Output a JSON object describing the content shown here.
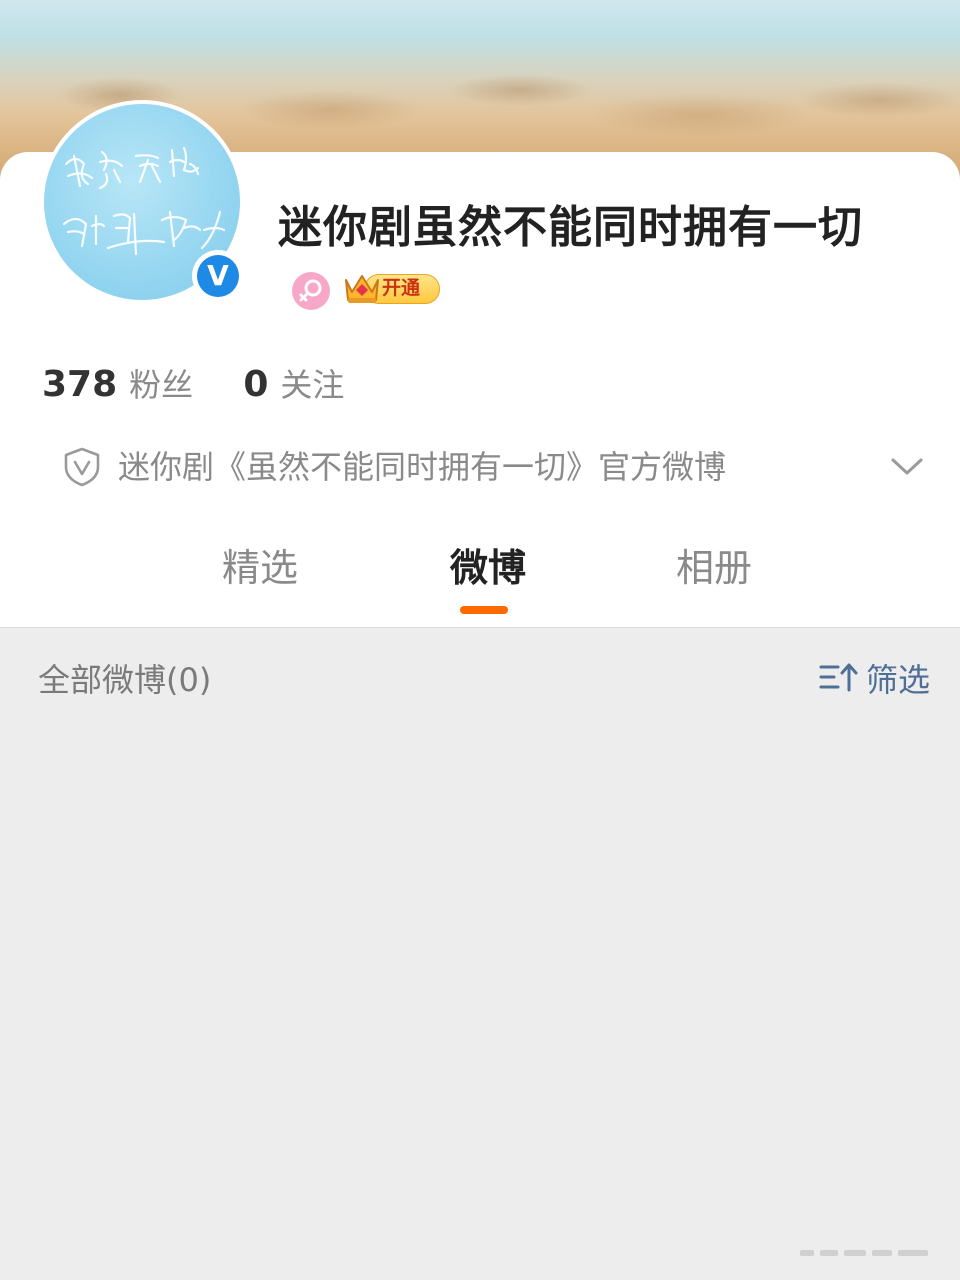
{
  "profile": {
    "name": "迷你剧虽然不能同时拥有一切",
    "avatar_text": "虽然不能同时拥有一切",
    "verified_badge": "V",
    "vip_label": "开通"
  },
  "stats": {
    "followers_count": "378",
    "followers_label": "粉丝",
    "following_count": "0",
    "following_label": "关注"
  },
  "description": {
    "text": "迷你剧《虽然不能同时拥有一切》官方微博"
  },
  "tabs": [
    {
      "label": "精选",
      "active": false
    },
    {
      "label": "微博",
      "active": true
    },
    {
      "label": "相册",
      "active": false
    }
  ],
  "feed": {
    "all_posts_label": "全部微博(0)",
    "filter_label": "筛选"
  },
  "colors": {
    "accent": "#ff6a00",
    "verified": "#1e8ae6",
    "filter": "#4f6f96"
  }
}
